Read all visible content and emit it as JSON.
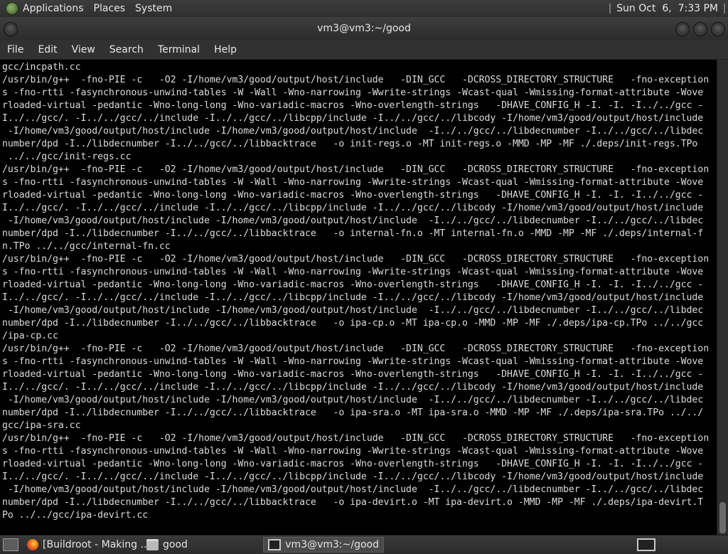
{
  "top_panel": {
    "menus": [
      "Applications",
      "Places",
      "System"
    ],
    "clock": "Sun Oct  6,  7:33 PM"
  },
  "window": {
    "title": "vm3@vm3:~/good"
  },
  "menubar": {
    "items": [
      "File",
      "Edit",
      "View",
      "Search",
      "Terminal",
      "Help"
    ]
  },
  "terminal": {
    "lines": [
      "gcc/incpath.cc",
      "/usr/bin/g++  -fno-PIE -c   -O2 -I/home/vm3/good/output/host/include   -DIN_GCC   -DCROSS_DIRECTORY_STRUCTURE   -fno-exception",
      "s -fno-rtti -fasynchronous-unwind-tables -W -Wall -Wno-narrowing -Wwrite-strings -Wcast-qual -Wmissing-format-attribute -Wove",
      "rloaded-virtual -pedantic -Wno-long-long -Wno-variadic-macros -Wno-overlength-strings   -DHAVE_CONFIG_H -I. -I. -I../../gcc -",
      "I../../gcc/. -I../../gcc/../include -I../../gcc/../libcpp/include -I../../gcc/../libcody -I/home/vm3/good/output/host/include",
      " -I/home/vm3/good/output/host/include -I/home/vm3/good/output/host/include  -I../../gcc/../libdecnumber -I../../gcc/../libdec",
      "number/dpd -I../libdecnumber -I../../gcc/../libbacktrace   -o init-regs.o -MT init-regs.o -MMD -MP -MF ./.deps/init-regs.TPo",
      " ../../gcc/init-regs.cc",
      "/usr/bin/g++  -fno-PIE -c   -O2 -I/home/vm3/good/output/host/include   -DIN_GCC   -DCROSS_DIRECTORY_STRUCTURE   -fno-exception",
      "s -fno-rtti -fasynchronous-unwind-tables -W -Wall -Wno-narrowing -Wwrite-strings -Wcast-qual -Wmissing-format-attribute -Wove",
      "rloaded-virtual -pedantic -Wno-long-long -Wno-variadic-macros -Wno-overlength-strings   -DHAVE_CONFIG_H -I. -I. -I../../gcc -",
      "I../../gcc/. -I../../gcc/../include -I../../gcc/../libcpp/include -I../../gcc/../libcody -I/home/vm3/good/output/host/include",
      " -I/home/vm3/good/output/host/include -I/home/vm3/good/output/host/include  -I../../gcc/../libdecnumber -I../../gcc/../libdec",
      "number/dpd -I../libdecnumber -I../../gcc/../libbacktrace   -o internal-fn.o -MT internal-fn.o -MMD -MP -MF ./.deps/internal-f",
      "n.TPo ../../gcc/internal-fn.cc",
      "/usr/bin/g++  -fno-PIE -c   -O2 -I/home/vm3/good/output/host/include   -DIN_GCC   -DCROSS_DIRECTORY_STRUCTURE   -fno-exception",
      "s -fno-rtti -fasynchronous-unwind-tables -W -Wall -Wno-narrowing -Wwrite-strings -Wcast-qual -Wmissing-format-attribute -Wove",
      "rloaded-virtual -pedantic -Wno-long-long -Wno-variadic-macros -Wno-overlength-strings   -DHAVE_CONFIG_H -I. -I. -I../../gcc -",
      "I../../gcc/. -I../../gcc/../include -I../../gcc/../libcpp/include -I../../gcc/../libcody -I/home/vm3/good/output/host/include",
      " -I/home/vm3/good/output/host/include -I/home/vm3/good/output/host/include  -I../../gcc/../libdecnumber -I../../gcc/../libdec",
      "number/dpd -I../libdecnumber -I../../gcc/../libbacktrace   -o ipa-cp.o -MT ipa-cp.o -MMD -MP -MF ./.deps/ipa-cp.TPo ../../gcc",
      "/ipa-cp.cc",
      "/usr/bin/g++  -fno-PIE -c   -O2 -I/home/vm3/good/output/host/include   -DIN_GCC   -DCROSS_DIRECTORY_STRUCTURE   -fno-exception",
      "s -fno-rtti -fasynchronous-unwind-tables -W -Wall -Wno-narrowing -Wwrite-strings -Wcast-qual -Wmissing-format-attribute -Wove",
      "rloaded-virtual -pedantic -Wno-long-long -Wno-variadic-macros -Wno-overlength-strings   -DHAVE_CONFIG_H -I. -I. -I../../gcc -",
      "I../../gcc/. -I../../gcc/../include -I../../gcc/../libcpp/include -I../../gcc/../libcody -I/home/vm3/good/output/host/include",
      " -I/home/vm3/good/output/host/include -I/home/vm3/good/output/host/include  -I../../gcc/../libdecnumber -I../../gcc/../libdec",
      "number/dpd -I../libdecnumber -I../../gcc/../libbacktrace   -o ipa-sra.o -MT ipa-sra.o -MMD -MP -MF ./.deps/ipa-sra.TPo ../../",
      "gcc/ipa-sra.cc",
      "/usr/bin/g++  -fno-PIE -c   -O2 -I/home/vm3/good/output/host/include   -DIN_GCC   -DCROSS_DIRECTORY_STRUCTURE   -fno-exception",
      "s -fno-rtti -fasynchronous-unwind-tables -W -Wall -Wno-narrowing -Wwrite-strings -Wcast-qual -Wmissing-format-attribute -Wove",
      "rloaded-virtual -pedantic -Wno-long-long -Wno-variadic-macros -Wno-overlength-strings   -DHAVE_CONFIG_H -I. -I. -I../../gcc -",
      "I../../gcc/. -I../../gcc/../include -I../../gcc/../libcpp/include -I../../gcc/../libcody -I/home/vm3/good/output/host/include",
      " -I/home/vm3/good/output/host/include -I/home/vm3/good/output/host/include  -I../../gcc/../libdecnumber -I../../gcc/../libdec",
      "number/dpd -I../libdecnumber -I../../gcc/../libbacktrace   -o ipa-devirt.o -MT ipa-devirt.o -MMD -MP -MF ./.deps/ipa-devirt.T",
      "Po ../../gcc/ipa-devirt.cc"
    ]
  },
  "taskbar": {
    "tasks": [
      {
        "label": "[Buildroot - Making ...",
        "icon": "firefox-icon"
      },
      {
        "label": "good",
        "icon": "folder-icon"
      },
      {
        "label": "vm3@vm3:~/good",
        "icon": "terminal-icon"
      }
    ]
  }
}
